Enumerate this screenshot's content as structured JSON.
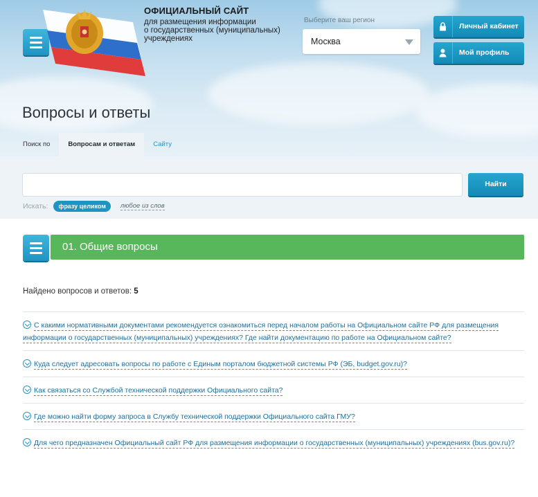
{
  "header": {
    "site_title": "ОФИЦИАЛЬНЫЙ САЙТ",
    "site_subtitle_1": "для размещения информации",
    "site_subtitle_2": "о государственных (муниципальных)",
    "site_subtitle_3": "учреждениях",
    "region_label": "Выберите ваш регион",
    "region_value": "Москва",
    "cabinet_label": "Личный кабинет",
    "profile_label": "Мой профиль"
  },
  "page": {
    "title": "Вопросы и ответы"
  },
  "tabs": {
    "prefix": "Поиск по",
    "active": "Вопросам и ответам",
    "other": "Сайту"
  },
  "search": {
    "value": "",
    "placeholder": "",
    "button": "Найти",
    "mode_label": "Искать:",
    "mode_selected": "фразу целиком",
    "mode_other": "любое из слов"
  },
  "category": {
    "title": "01. Общие вопросы"
  },
  "results": {
    "found_label": "Найдено вопросов и ответов:",
    "found_count": "5"
  },
  "questions": [
    {
      "text": "С какими нормативными документами рекомендуется ознакомиться перед началом работы на Официальном сайте РФ для размещения информации о государственных (муниципальных) учреждениях? Где найти документацию по работе на Официальном сайте?"
    },
    {
      "text": "Куда следует адресовать вопросы по работе с Единым порталом бюджетной системы РФ (ЭБ, budget.gov.ru)?"
    },
    {
      "text": "Как связаться со Службой технической поддержки Официального сайта?"
    },
    {
      "text": "Где можно найти форму запроса в Службу технической поддержки Официального сайта ГМУ?"
    },
    {
      "text": "Для чего предназначен Официальный сайт РФ для размещения информации о государственных (муниципальных) учреждениях (bus.gov.ru)?"
    }
  ],
  "colors": {
    "accent_blue": "#1f93c2",
    "category_green": "#57b75a",
    "link": "#1f6f9b"
  },
  "icons": {
    "menu": "hamburger-icon",
    "cabinet": "lock-icon",
    "profile": "user-icon",
    "question": "chevron-circle-icon",
    "select": "dropdown-arrow-icon"
  }
}
